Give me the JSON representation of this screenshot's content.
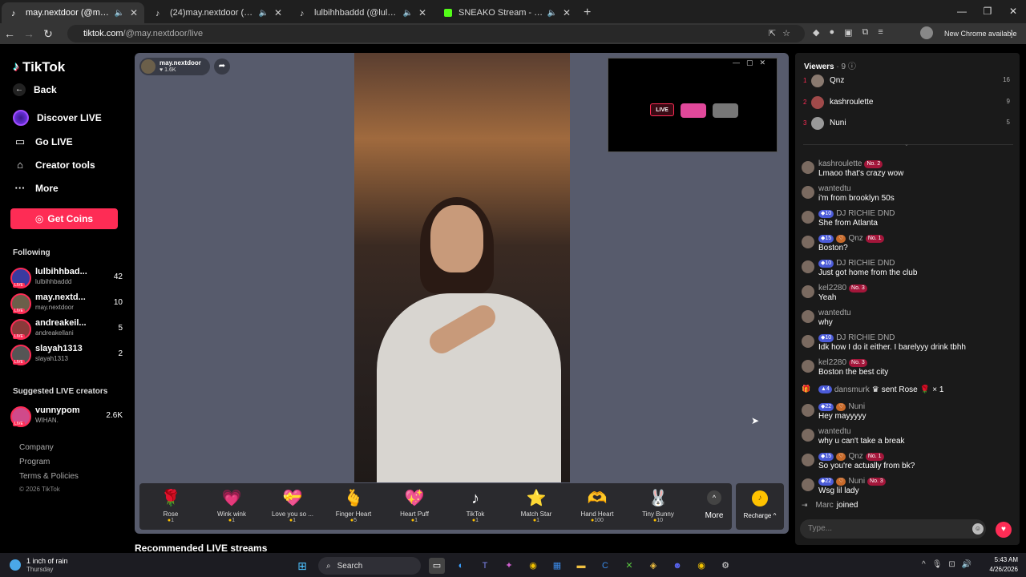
{
  "tabs": [
    {
      "title": "may.nextdoor (@may.nextdo",
      "active": true
    },
    {
      "title": "(24)may.nextdoor (@may.nextd",
      "active": false
    },
    {
      "title": "lulbihhbaddd (@lulbihhbad",
      "active": false
    },
    {
      "title": "SNEAKO Stream - Watch Li",
      "active": false
    }
  ],
  "address": {
    "domain": "tiktok.com",
    "path": "/@may.nextdoor/live",
    "new_chrome": "New Chrome available"
  },
  "sidebar": {
    "logo": "TikTok",
    "back": "Back",
    "nav": [
      "Discover LIVE",
      "Go LIVE",
      "Creator tools",
      "More"
    ],
    "get_coins": "Get Coins",
    "following_title": "Following",
    "following": [
      {
        "name": "lulbihhbad...",
        "handle": "lulbihhbaddd",
        "count": "42"
      },
      {
        "name": "may.nextd...",
        "handle": "may.nextdoor",
        "count": "10"
      },
      {
        "name": "andreakeil...",
        "handle": "andreakellani",
        "count": "5"
      },
      {
        "name": "slayah1313",
        "handle": "slayah1313",
        "count": "2"
      }
    ],
    "suggested_title": "Suggested LIVE creators",
    "suggested": [
      {
        "name": "vunnypom",
        "handle": "WIHAN.",
        "count": "2.6K"
      }
    ],
    "footer": [
      "Company",
      "Program",
      "Terms & Policies"
    ],
    "copyright": "© 2026 TikTok"
  },
  "stream": {
    "streamer": "may.nextdoor",
    "likes": "1.6K",
    "pip_live": "LIVE",
    "gifts": [
      {
        "name": "Rose",
        "price": "1",
        "icon": "🌹"
      },
      {
        "name": "Wink wink",
        "price": "1",
        "icon": "💗"
      },
      {
        "name": "Love you so ...",
        "price": "1",
        "icon": "💝"
      },
      {
        "name": "Finger Heart",
        "price": "5",
        "icon": "🫰"
      },
      {
        "name": "Heart Puff",
        "price": "1",
        "icon": "💖"
      },
      {
        "name": "TikTok",
        "price": "1",
        "icon": "♪"
      },
      {
        "name": "Match Star",
        "price": "1",
        "icon": "⭐"
      },
      {
        "name": "Hand Heart",
        "price": "100",
        "icon": "🫶"
      },
      {
        "name": "Tiny Bunny",
        "price": "10",
        "icon": "🐰"
      }
    ],
    "more": "More",
    "recharge": "Recharge ^",
    "recommended": "Recommended LIVE streams"
  },
  "chat": {
    "viewers_label": "Viewers",
    "viewers_count": "· 9",
    "top": [
      {
        "rank": "1",
        "name": "Qnz",
        "score": "16"
      },
      {
        "rank": "2",
        "name": "kashroulette",
        "score": "9"
      },
      {
        "rank": "3",
        "name": "Nuni",
        "score": "5"
      }
    ],
    "messages": [
      {
        "user": "kashroulette",
        "level": "",
        "fan": "",
        "no": "No. 2",
        "text": "Lmaoo that's crazy wow"
      },
      {
        "user": "wantedtu",
        "level": "",
        "fan": "",
        "no": "",
        "text": "i'm from brooklyn 50s"
      },
      {
        "user": "DJ RICHIE DND",
        "level": "10",
        "fan": "",
        "no": "",
        "text": "She from Atlanta"
      },
      {
        "user": "Qnz",
        "level": "15",
        "fan": "♡",
        "no": "No. 1",
        "text": "Boston?"
      },
      {
        "user": "DJ RICHIE DND",
        "level": "10",
        "fan": "",
        "no": "",
        "text": "Just got home from the club"
      },
      {
        "user": "kel2280",
        "level": "",
        "fan": "",
        "no": "No. 3",
        "text": "Yeah"
      },
      {
        "user": "wantedtu",
        "level": "",
        "fan": "",
        "no": "",
        "text": "why"
      },
      {
        "user": "DJ RICHIE DND",
        "level": "10",
        "fan": "",
        "no": "",
        "text": "Idk how I do it either. I barelyyy drink tbhh"
      },
      {
        "user": "kel2280",
        "level": "",
        "fan": "",
        "no": "No. 3",
        "text": "Boston the best city"
      }
    ],
    "gift_event": {
      "level": "4",
      "user": "dansmurk",
      "text": "sent Rose",
      "count": "× 1"
    },
    "messages2": [
      {
        "user": "Nuni",
        "level": "22",
        "fan": "♡",
        "no": "",
        "text": "Hey mayyyyy"
      },
      {
        "user": "wantedtu",
        "level": "",
        "fan": "",
        "no": "",
        "text": "why u can't take a break"
      },
      {
        "user": "Qnz",
        "level": "15",
        "fan": "♡",
        "no": "No. 1",
        "text": "So you're actually from bk?"
      },
      {
        "user": "Nuni",
        "level": "22",
        "fan": "♡",
        "no": "No. 3",
        "text": "Wsg lil lady"
      }
    ],
    "joined": {
      "user": "Marc",
      "text": "joined"
    },
    "input_placeholder": "Type..."
  },
  "taskbar": {
    "weather_line1": "1 inch of rain",
    "weather_line2": "Thursday",
    "search": "Search",
    "time": "5:43 AM",
    "date": "4/26/2026"
  }
}
